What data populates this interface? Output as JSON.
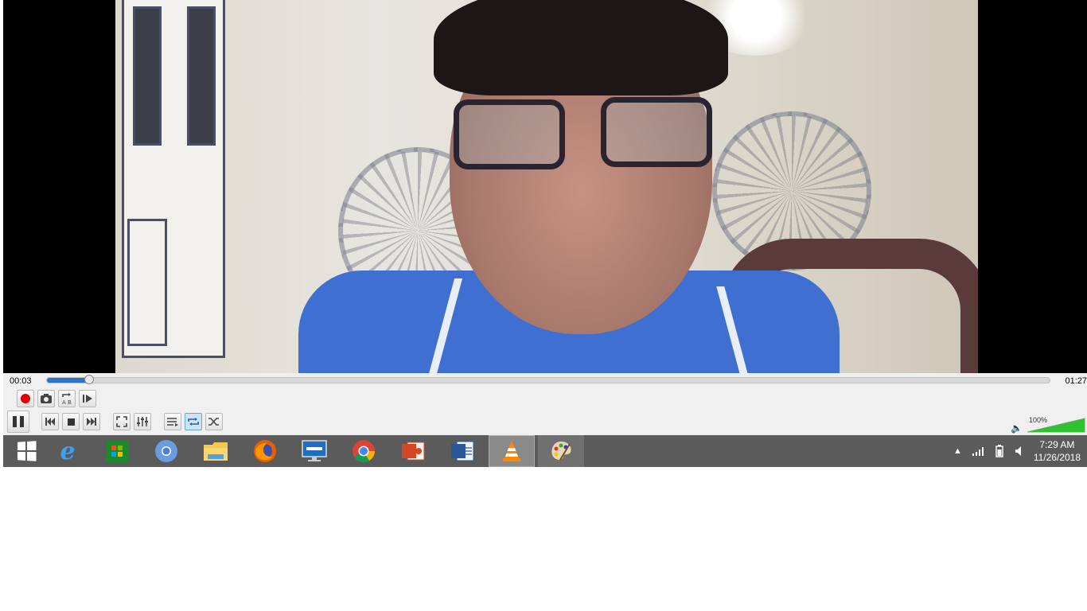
{
  "player": {
    "elapsed": "00:03",
    "duration": "01:27",
    "progress_fraction": 0.042,
    "volume_label": "100%",
    "volume_fraction": 1.0,
    "colors": {
      "seek_fill": "#2b73c8",
      "volume_fill": "#2fc12f",
      "record": "#e00000"
    },
    "controls_row1": [
      {
        "name": "record-button",
        "icon": "record-icon"
      },
      {
        "name": "snapshot-button",
        "icon": "camera-icon"
      },
      {
        "name": "ab-loop-button",
        "icon": "ab-loop-icon"
      },
      {
        "name": "frame-by-frame-button",
        "icon": "frame-step-icon"
      }
    ],
    "controls_row2": [
      {
        "name": "pause-button",
        "icon": "pause-icon"
      },
      {
        "name": "previous-button",
        "icon": "skip-previous-icon"
      },
      {
        "name": "stop-button",
        "icon": "stop-icon"
      },
      {
        "name": "next-button",
        "icon": "skip-next-icon"
      },
      {
        "name": "fullscreen-button",
        "icon": "fullscreen-icon"
      },
      {
        "name": "extended-settings-button",
        "icon": "equalizer-icon"
      },
      {
        "name": "playlist-button",
        "icon": "playlist-icon"
      },
      {
        "name": "loop-button",
        "icon": "loop-icon",
        "active": true
      },
      {
        "name": "shuffle-button",
        "icon": "shuffle-icon"
      }
    ]
  },
  "taskbar": {
    "apps": [
      {
        "name": "start-button",
        "icon": "windows-logo-icon"
      },
      {
        "name": "internet-explorer",
        "icon": "internet-explorer-icon"
      },
      {
        "name": "store",
        "icon": "store-icon"
      },
      {
        "name": "chromium",
        "icon": "chromium-icon"
      },
      {
        "name": "file-explorer",
        "icon": "folder-icon"
      },
      {
        "name": "firefox",
        "icon": "firefox-icon"
      },
      {
        "name": "lenovo",
        "icon": "lenovo-monitor-icon"
      },
      {
        "name": "chrome",
        "icon": "chrome-icon"
      },
      {
        "name": "powerpoint",
        "icon": "powerpoint-icon"
      },
      {
        "name": "word",
        "icon": "word-icon"
      },
      {
        "name": "vlc",
        "icon": "vlc-cone-icon",
        "state": "active"
      },
      {
        "name": "paint",
        "icon": "paint-palette-icon",
        "state": "open"
      }
    ],
    "tray": {
      "time": "7:29 AM",
      "date": "11/26/2018"
    }
  }
}
